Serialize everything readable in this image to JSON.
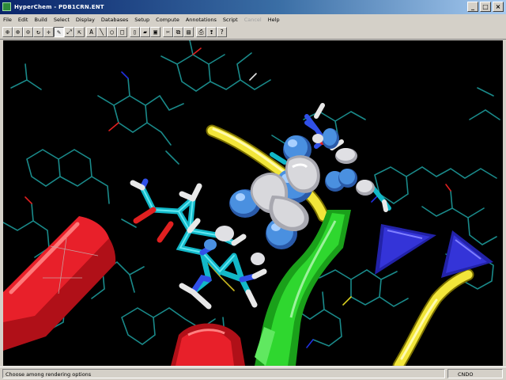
{
  "window": {
    "title": "HyperChem - PDB1CRN.ENT",
    "controls": [
      "minimize",
      "maximize",
      "close"
    ]
  },
  "menu": [
    "File",
    "Edit",
    "Build",
    "Select",
    "Display",
    "Databases",
    "Setup",
    "Compute",
    "Annotations",
    "Script",
    "Cancel",
    "Help"
  ],
  "menu_disabled": [
    "Cancel"
  ],
  "toolbar": {
    "buttons": [
      {
        "name": "draw-tool",
        "glyph": "⊕"
      },
      {
        "name": "select-tool",
        "glyph": "⊗"
      },
      {
        "name": "rotate-xy-tool",
        "glyph": "⊙"
      },
      {
        "name": "rotate-z-tool",
        "glyph": "↻"
      },
      {
        "name": "translate-xy-tool",
        "glyph": "✛"
      },
      {
        "name": "translate-z-tool",
        "glyph": "✎"
      },
      {
        "name": "zoom-tool",
        "glyph": "⤢"
      },
      {
        "name": "z-clip-tool",
        "glyph": "⇱"
      },
      {
        "name": "text-tool",
        "glyph": "A"
      },
      {
        "name": "line-tool",
        "glyph": "╲"
      },
      {
        "name": "ellipse-tool",
        "glyph": "○"
      },
      {
        "name": "rectangle-tool",
        "glyph": "□"
      },
      {
        "name": "new-file",
        "glyph": "▯"
      },
      {
        "name": "open-file",
        "glyph": "▰"
      },
      {
        "name": "save-file",
        "glyph": "▣"
      },
      {
        "name": "cut",
        "glyph": "✂"
      },
      {
        "name": "copy",
        "glyph": "⧉"
      },
      {
        "name": "paste",
        "glyph": "▤"
      },
      {
        "name": "print",
        "glyph": "⎙"
      },
      {
        "name": "hint",
        "glyph": "❢"
      },
      {
        "name": "help",
        "glyph": "?"
      }
    ]
  },
  "viewport": {
    "scene": "molecular-structure",
    "background": "#000000",
    "colors": {
      "helix": "#e8202a",
      "sheet": "#2fd72f",
      "coil": "#f2e63a",
      "wireframe": "#1a8a8a",
      "orbital_blue": "#4a90e0",
      "orbital_white": "#d8d8dc",
      "arrow": "#3434d8"
    }
  },
  "status": {
    "message": "Choose among rendering options",
    "mode": "CNDO"
  }
}
